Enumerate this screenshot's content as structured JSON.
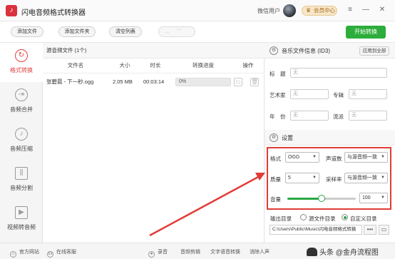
{
  "window": {
    "title": "闪电音频格式转换器",
    "user_label": "微信用户",
    "vip_label": "会员中心",
    "controls": [
      "≡",
      "—",
      "✕"
    ]
  },
  "toolbar": {
    "add_file": "添加文件",
    "add_folder": "添加文件夹",
    "clear_list": "清空列表",
    "start_convert": "开始转换",
    "accent_color": "#2dad3b"
  },
  "sidebar": {
    "items": [
      {
        "label": "格式转换",
        "icon": "refresh-icon",
        "active": true
      },
      {
        "label": "音频合并",
        "icon": "merge-icon",
        "active": false
      },
      {
        "label": "音频压缩",
        "icon": "compress-icon",
        "active": false
      },
      {
        "label": "音频分割",
        "icon": "split-icon",
        "active": false
      },
      {
        "label": "视频转音频",
        "icon": "video-icon",
        "active": false
      }
    ]
  },
  "file_list": {
    "header": "源音频文件 (1个)",
    "columns": [
      "文件名",
      "大小",
      "时长",
      "转换进度",
      "操作"
    ],
    "rows": [
      {
        "name": "张碧晨 - 下一秒.ogg",
        "size": "2.05 MB",
        "duration": "00:03:14",
        "progress": "0%",
        "progress_value": 0
      }
    ]
  },
  "id3": {
    "title": "音乐文件信息 (ID3)",
    "apply_all": "应用到全部",
    "fields": {
      "title_label": "标　题",
      "artist_label": "艺术家",
      "album_label": "专辑",
      "year_label": "年　份",
      "genre_label": "流派",
      "placeholder": "无"
    }
  },
  "settings": {
    "title": "设置",
    "format_label": "格式",
    "format_value": "OGG",
    "channels_label": "声道数",
    "channels_value": "与源音频一致",
    "quality_label": "质量",
    "quality_value": "5",
    "samplerate_label": "采样率",
    "samplerate_value": "与源音频一致",
    "volume_label": "音量",
    "volume_value": "100",
    "volume_fraction": 0.5,
    "highlight_color": "#e23b36"
  },
  "output": {
    "label": "输出目录",
    "opt_source": "源文件目录",
    "opt_custom": "自定义目录",
    "selected": "custom",
    "path": "C:\\Users\\Public\\Music\\闪电音频格式转换",
    "browse": "•••"
  },
  "statusbar": {
    "website": "官方网站",
    "support": "在线客服",
    "record": "录音",
    "edit": "音频剪辑",
    "tts": "文字语音转换",
    "vocal": "消除人声"
  },
  "watermark": "头条 @金舟流程图"
}
